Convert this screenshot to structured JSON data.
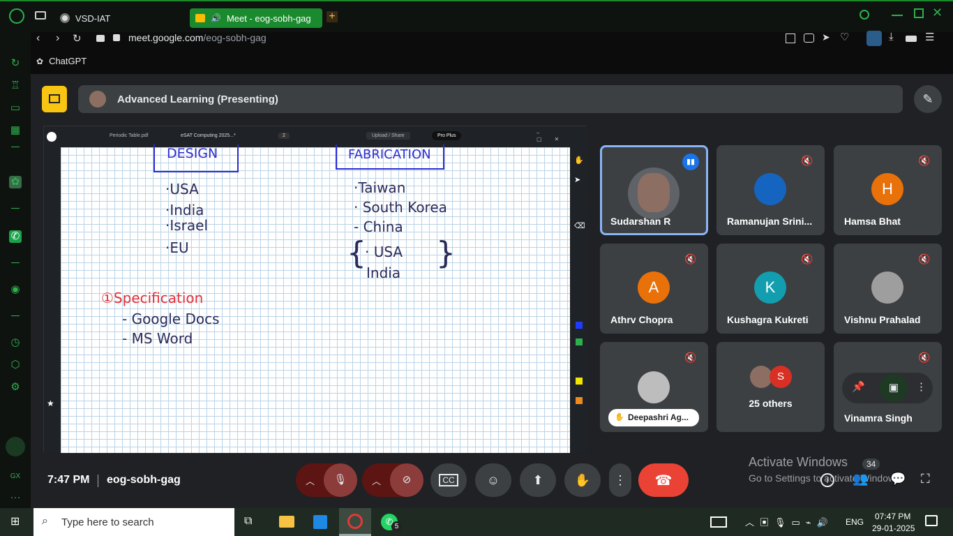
{
  "browser": {
    "tabs": [
      {
        "label": "VSD-IAT",
        "active": false
      },
      {
        "label": "Meet - eog-sobh-gag",
        "active": true
      }
    ],
    "url_domain": "meet.google.com",
    "url_path": "/eog-sobh-gag",
    "bookmark": "ChatGPT"
  },
  "meet": {
    "presenting_label": "Advanced Learning (Presenting)",
    "time": "7:47 PM",
    "meeting_code": "eog-sobh-gag",
    "participant_count": "34",
    "activate_title": "Activate Windows",
    "activate_sub": "Go to Settings to activate Windows."
  },
  "shared_screen": {
    "tabs": [
      "Periodic Table.pdf",
      "eSAT Computing 2025...*"
    ],
    "page_badge": "2",
    "upload_label": "Upload / Share",
    "plan_label": "Pro Plus",
    "board": {
      "design_header": "DESIGN",
      "design_items": [
        "·USA",
        "·India",
        "·Israel",
        "·EU"
      ],
      "fab_header": "FABRICATION",
      "fab_items": [
        "·Taiwan",
        "· South Korea",
        "- China",
        "· USA",
        "India"
      ],
      "spec_title": "①Specification",
      "spec_items": [
        "- Google Docs",
        "- MS Word"
      ]
    }
  },
  "participants": [
    {
      "name": "Sudarshan R",
      "avatar": "photo",
      "color": "#6d4c41",
      "speaking": true
    },
    {
      "name": "Ramanujan Srini...",
      "avatar": "photo",
      "color": "#1565c0",
      "speaking": false
    },
    {
      "name": "Hamsa Bhat",
      "avatar": "H",
      "color": "#e8710a",
      "speaking": false
    },
    {
      "name": "Athrv Chopra",
      "avatar": "A",
      "color": "#e8710a",
      "speaking": false
    },
    {
      "name": "Kushagra Kukreti",
      "avatar": "K",
      "color": "#129eaf",
      "speaking": false
    },
    {
      "name": "Vishnu Prahalad",
      "avatar": "photo",
      "color": "#9e9e9e",
      "speaking": false
    },
    {
      "name": "Deepashri Ag...",
      "avatar": "photo",
      "color": "#bdbdbd",
      "speaking": false
    },
    {
      "name": "25 others",
      "avatar": "S",
      "color": "#d93025",
      "speaking": false
    },
    {
      "name": "Vinamra Singh",
      "avatar": "",
      "color": "#3c4043",
      "speaking": false
    }
  ],
  "taskbar": {
    "search_placeholder": "Type here to search",
    "whatsapp_badge": "5",
    "lang": "ENG",
    "clock_time": "07:47 PM",
    "clock_date": "29-01-2025"
  }
}
